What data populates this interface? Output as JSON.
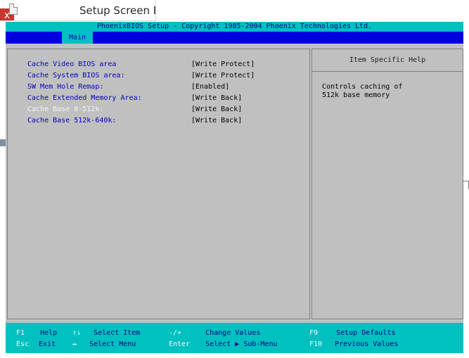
{
  "host": {
    "title": "Setup Screen Er",
    "close_glyph": "x"
  },
  "bios": {
    "title": "PhoenixBIOS Setup - Copyright 1985-2004 Phoenix Technologies Ltd.",
    "menu_tabs": [
      {
        "label": "Main"
      }
    ],
    "settings": [
      {
        "label": "Cache Video BIOS area",
        "value": "[Write Protect]",
        "dim": false
      },
      {
        "label": "Cache System BIOS area:",
        "value": "[Write Protect]",
        "dim": false
      },
      {
        "label": "SW Mem Hole Remap:",
        "value": "[Enabled]",
        "dim": false
      },
      {
        "label": "Cache Extended Memory Area:",
        "value": "[Write Back]",
        "dim": false
      },
      {
        "label": "Cache Base 0-512k:",
        "value": "[Write Back]",
        "dim": true
      },
      {
        "label": "Cache Base 512k-640k:",
        "value": "[Write Back]",
        "dim": false
      }
    ],
    "help": {
      "header": "Item Specific Help",
      "lines": [
        "Controls caching of",
        "512k  base memory"
      ]
    },
    "keys": [
      {
        "key": "F1",
        "action": "Help"
      },
      {
        "key": "↑↓",
        "action": "Select Item"
      },
      {
        "key": "-/+",
        "action": "Change Values"
      },
      {
        "key": "F9",
        "action": "Setup Defaults"
      },
      {
        "key": "Esc",
        "action": "Exit"
      },
      {
        "key": "↔",
        "action": "Select Menu"
      },
      {
        "key": "Enter",
        "action": "Select ▶ Sub-Menu"
      },
      {
        "key": "F10",
        "action": "Previous Values"
      }
    ]
  }
}
